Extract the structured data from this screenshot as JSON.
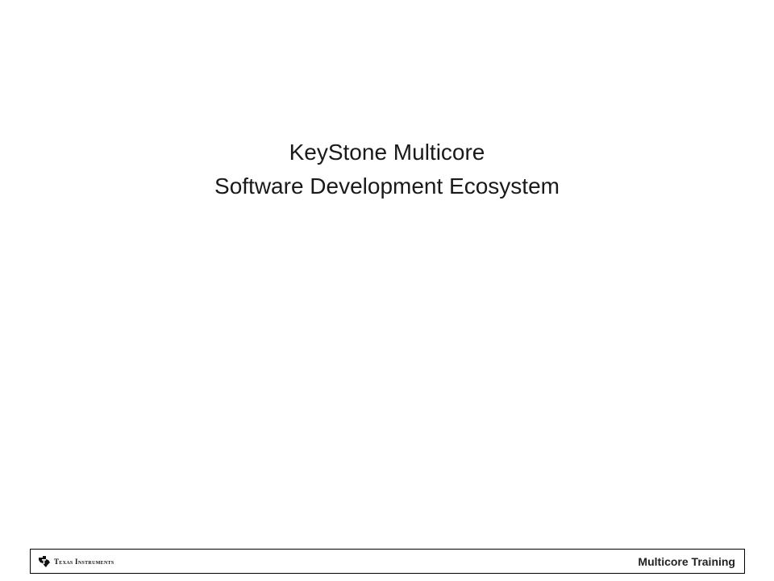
{
  "slide": {
    "title_line1": "KeyStone Multicore",
    "title_line2": "Software Development Ecosystem"
  },
  "footer": {
    "logo_text": "Texas Instruments",
    "logo_icon": "texas-state-icon",
    "training_label": "Multicore Training"
  }
}
